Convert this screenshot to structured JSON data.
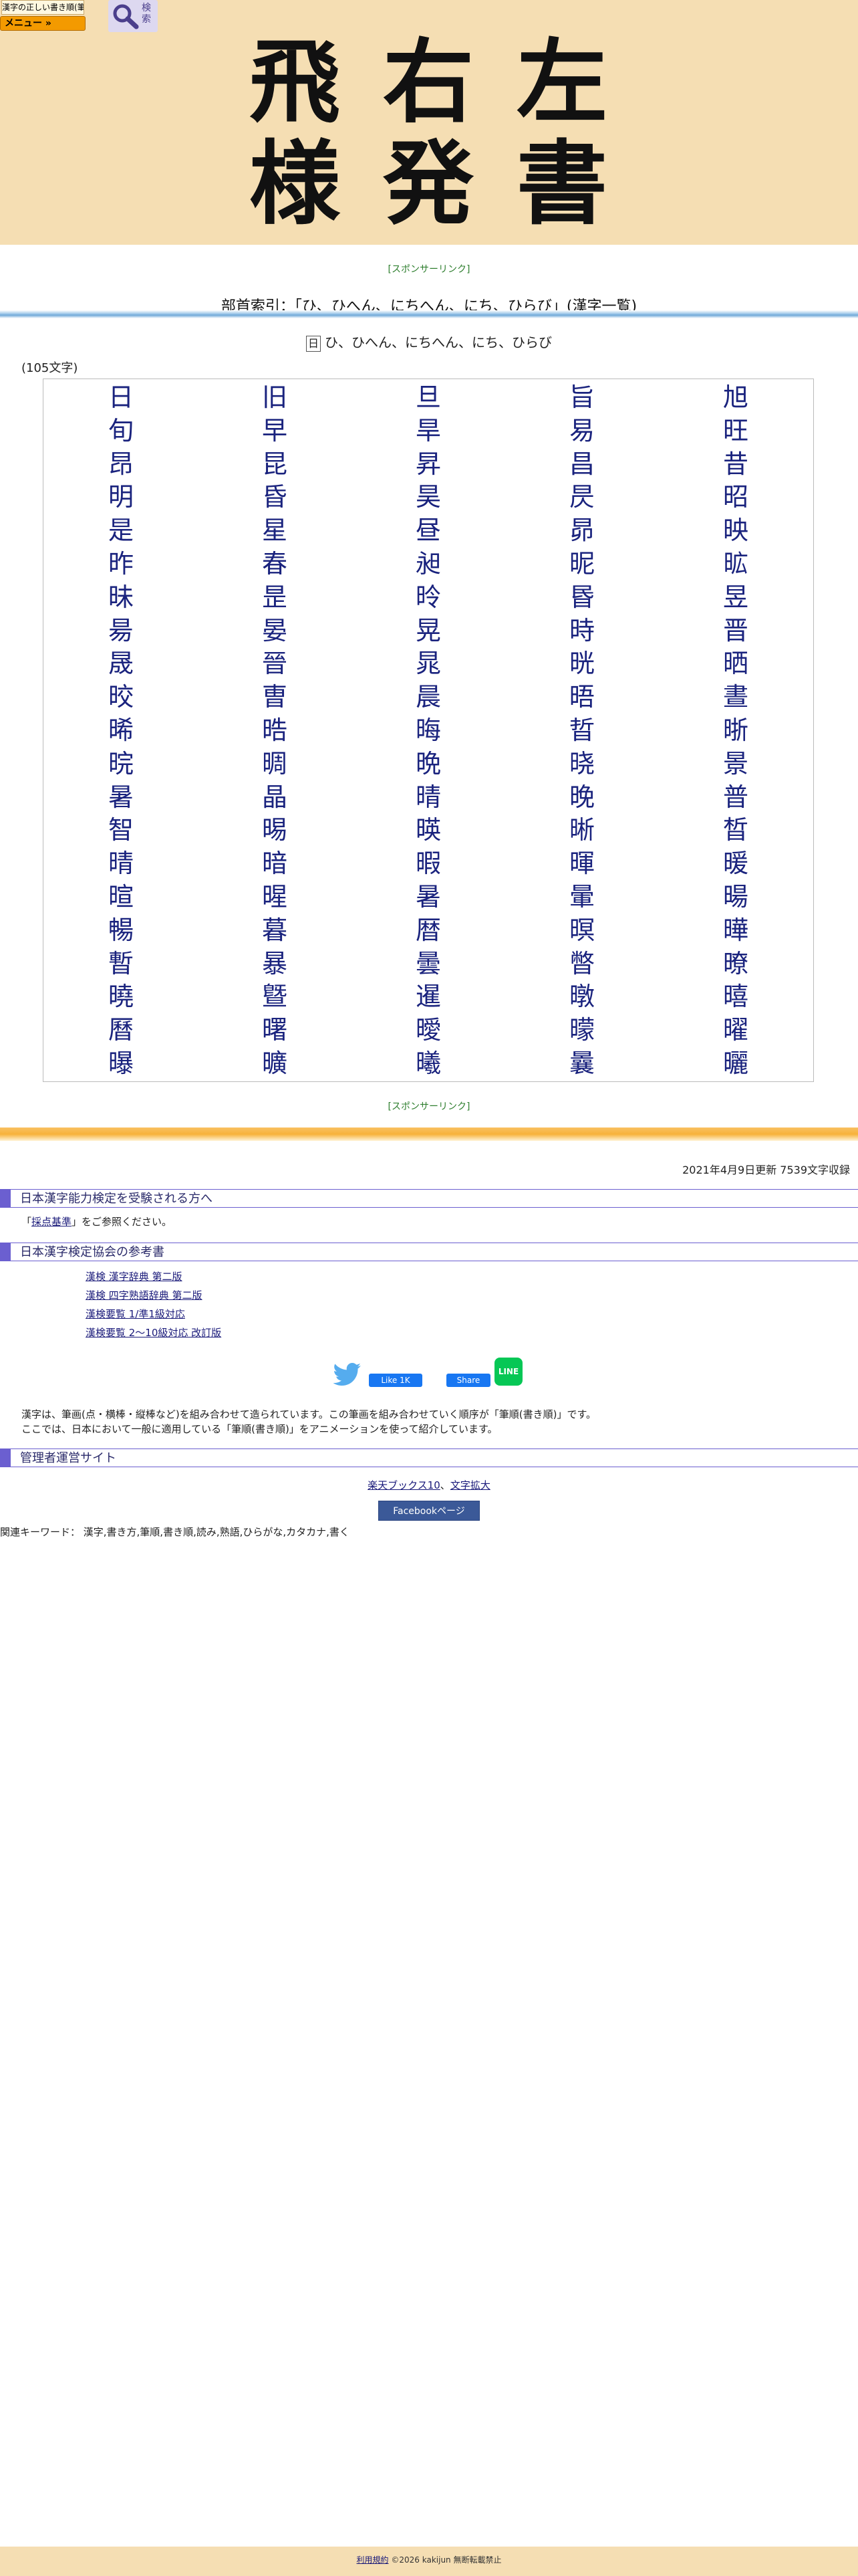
{
  "header": {
    "logo_text": "漢字の正しい書き順(筆順)",
    "menu_label": "メニュー »",
    "search_label": "検索",
    "title_chars": [
      "飛",
      "右",
      "左",
      "様",
      "発",
      "書"
    ]
  },
  "sponsor_link": "[スポンサーリンク]",
  "page_heading": "部首索引：「ひ、ひへん、にちへん、にち、ひらび」(漢字一覧)",
  "radical": {
    "glyph": "日",
    "readings": "ひ、ひへん、にちへん、にち、ひらび"
  },
  "count_label": "(105文字)",
  "kanji": [
    "日",
    "旧",
    "旦",
    "旨",
    "旭",
    "旬",
    "早",
    "旱",
    "易",
    "旺",
    "昂",
    "昆",
    "昇",
    "昌",
    "昔",
    "明",
    "昏",
    "昊",
    "昃",
    "昭",
    "是",
    "星",
    "昼",
    "昴",
    "映",
    "昨",
    "春",
    "昶",
    "昵",
    "昿",
    "昧",
    "昰",
    "昤",
    "昬",
    "昱",
    "昜",
    "晏",
    "晃",
    "時",
    "晋",
    "晟",
    "晉",
    "晁",
    "晄",
    "晒",
    "晈",
    "曺",
    "晨",
    "晤",
    "晝",
    "晞",
    "晧",
    "晦",
    "晢",
    "晣",
    "晥",
    "晭",
    "晩",
    "晓",
    "景",
    "暑",
    "晶",
    "晴",
    "晚",
    "普",
    "智",
    "晹",
    "暎",
    "晰",
    "晳",
    "晴",
    "暗",
    "暇",
    "暉",
    "暖",
    "暄",
    "暒",
    "暑",
    "暈",
    "暘",
    "暢",
    "暮",
    "暦",
    "暝",
    "曄",
    "暫",
    "暴",
    "曇",
    "暼",
    "暸",
    "曉",
    "曁",
    "暹",
    "暾",
    "暿",
    "曆",
    "曙",
    "曖",
    "曚",
    "曜",
    "曝",
    "曠",
    "曦",
    "曩",
    "曬"
  ],
  "update_info": "2021年4月9日更新 7539文字収録",
  "section_exam": {
    "title": "日本漢字能力検定を受験される方へ",
    "text_before": "「",
    "link": "採点基準",
    "text_after": "」をご参照ください。"
  },
  "section_refs": {
    "title": "日本漢字検定協会の参考書",
    "links": [
      "漢検 漢字辞典 第二版",
      "漢検 四字熟語辞典 第二版",
      "漢検要覧 1/準1級対応",
      "漢検要覧 2～10級対応 改訂版"
    ]
  },
  "share": {
    "fb_like": "Like 1K",
    "fb_share": "Share",
    "line": "LINE"
  },
  "description": {
    "line1": "漢字は、筆画(点・横棒・縦棒など)を組み合わせて造られています。この筆画を組み合わせていく順序が「筆順(書き順)」です。",
    "line2": "ここでは、日本において一般に適用している「筆順(書き順)」をアニメーションを使って紹介しています。"
  },
  "section_admin": {
    "title": "管理者運営サイト"
  },
  "footer": {
    "link1": "楽天ブックス10",
    "separator": "、",
    "link2": "文字拡大",
    "fb_page": "Facebookページ",
    "keywords": "関連キーワード： 漢字,書き方,筆順,書き順,読み,熟語,ひらがな,カタカナ,書く",
    "terms": "利用規約",
    "copyright": "©2026 kakijun 無断転載禁止"
  },
  "colors": {
    "header_bg": "#f5deb3",
    "kanji_link": "#1a237e",
    "section_accent": "#6b5fd0",
    "sponsor_green": "#2f7f2f"
  }
}
